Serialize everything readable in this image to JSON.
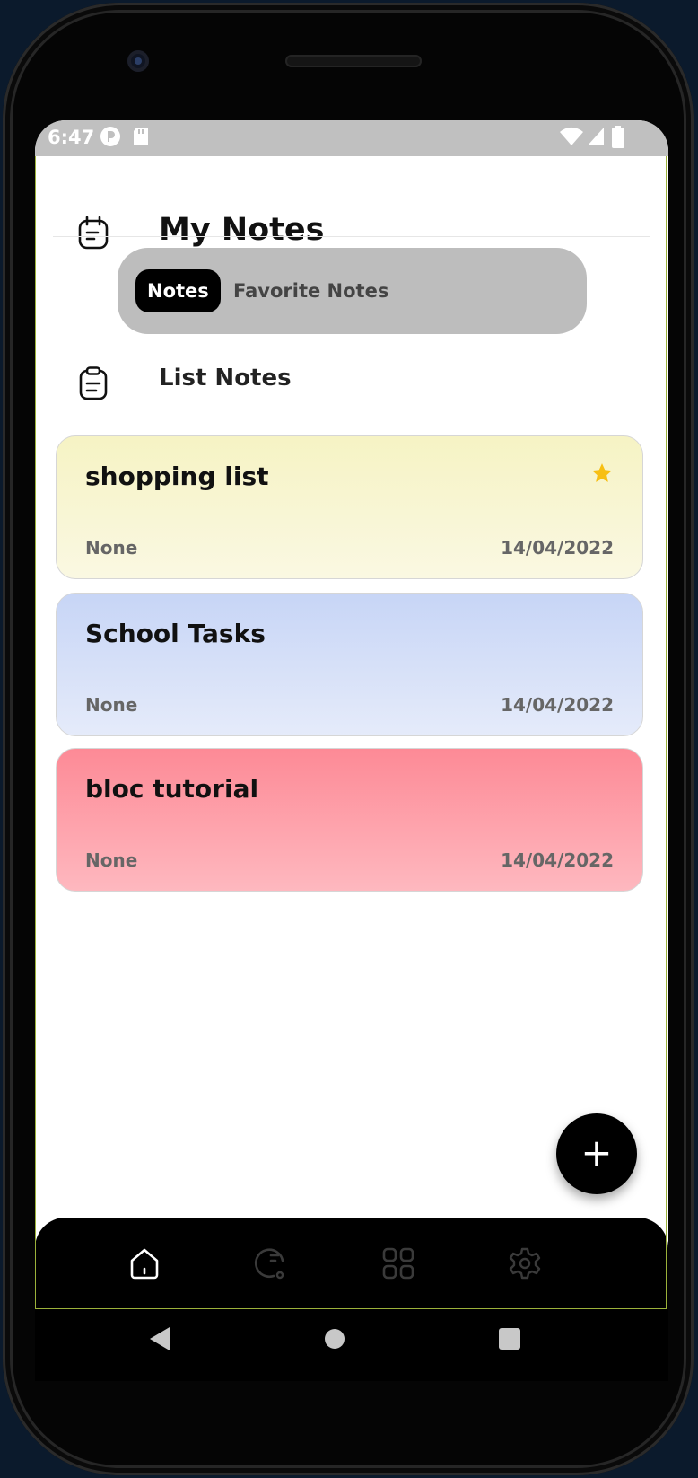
{
  "status_bar": {
    "time": "6:47"
  },
  "header": {
    "title": "My Notes",
    "icon": "notepad-icon"
  },
  "tabs": [
    {
      "label": "Notes",
      "active": true
    },
    {
      "label": "Favorite Notes",
      "active": false
    }
  ],
  "section": {
    "title": "List Notes",
    "icon": "clipboard-icon"
  },
  "notes": [
    {
      "title": "shopping list",
      "subtitle": "None",
      "date": "14/04/2022",
      "favorite": true,
      "gradient": [
        "#f6f3c4",
        "#faf8e2"
      ]
    },
    {
      "title": "School Tasks",
      "subtitle": "None",
      "date": "14/04/2022",
      "favorite": false,
      "gradient": [
        "#c7d5f6",
        "#e5ebfa"
      ]
    },
    {
      "title": "bloc tutorial",
      "subtitle": "None",
      "date": "14/04/2022",
      "favorite": false,
      "gradient": [
        "#fd8a96",
        "#feb8bf"
      ]
    }
  ],
  "fab": {
    "label": "+"
  },
  "bottom_nav": [
    "home-icon",
    "history-icon",
    "grid-icon",
    "settings-icon"
  ],
  "colors": {
    "accent": "#000000",
    "star": "#f7bf13",
    "statusbar": "#c0c0c0"
  }
}
